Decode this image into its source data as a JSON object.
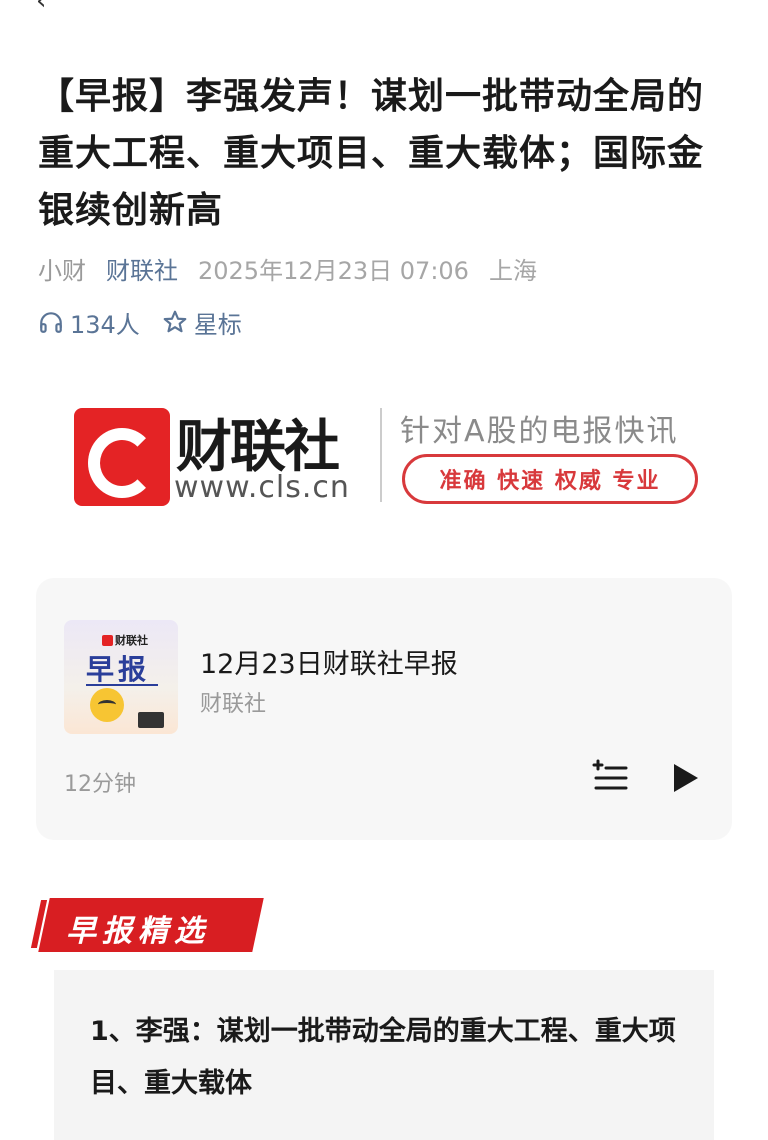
{
  "nav": {
    "back_icon": "back-arrow-icon",
    "back_glyph": "‹"
  },
  "article": {
    "title": "【早报】李强发声！谋划一批带动全局的重大工程、重大项目、重大载体；国际金银续创新高",
    "author": "小财",
    "source": "财联社",
    "datetime": "2025年12月23日 07:06",
    "location": "上海",
    "listeners": "134人",
    "star_label": "星标"
  },
  "banner": {
    "brand_name": "财联社",
    "url": "www.cls.cn",
    "tagline": "针对A股的电报快讯",
    "pill_text": "准确 快速 权威 专业"
  },
  "audio": {
    "cover_title": "早报",
    "cover_logo_text": "财联社",
    "title": "12月23日财联社早报",
    "source": "财联社",
    "duration": "12分钟"
  },
  "section": {
    "label": "早报精选"
  },
  "news": {
    "item1": "1、李强：谋划一批带动全局的重大工程、重大项目、重大载体"
  },
  "colors": {
    "brand_red": "#e42325",
    "link_blue": "#5a7496"
  }
}
